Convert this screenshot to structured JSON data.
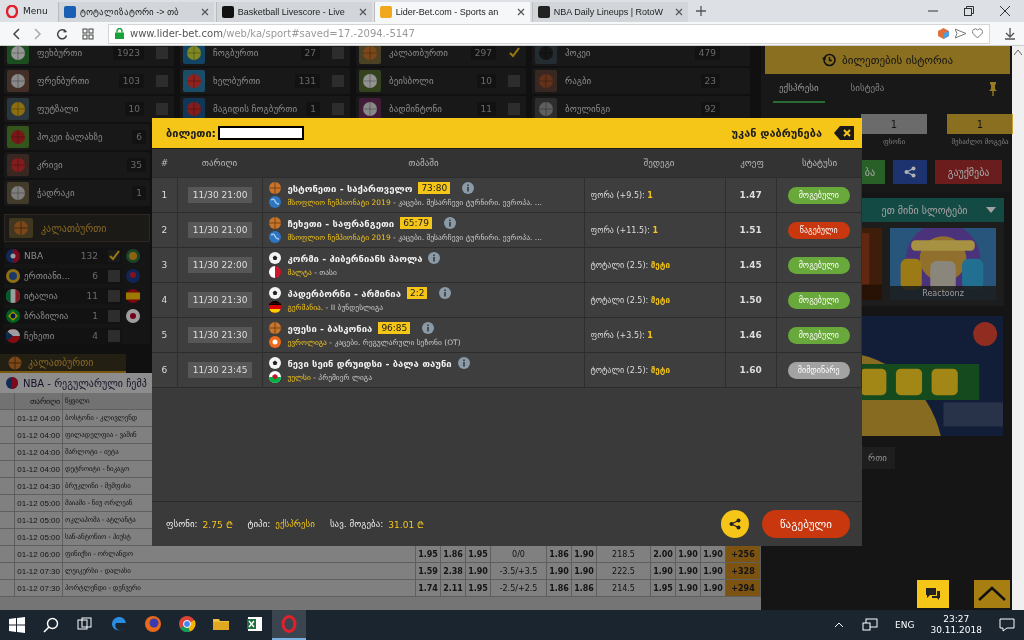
{
  "browser": {
    "menu": "Menu",
    "tabs": [
      {
        "label": "ტოტალიზატორი -> თბ",
        "selected": false
      },
      {
        "label": "Basketball Livescore - Live",
        "selected": false
      },
      {
        "label": "Lider-Bet.com - Sports an",
        "selected": true
      },
      {
        "label": "NBA Daily Lineups | RotoW",
        "selected": false
      }
    ],
    "url_host": "www.lider-bet.com",
    "url_path": "/web/ka/sport#saved=17.-2094.-5147"
  },
  "sports": [
    [
      {
        "name": "ფეხბურთი",
        "count": "1923",
        "checked": false,
        "kind": "football"
      },
      {
        "name": "ფრენბურთი",
        "count": "103",
        "checked": false,
        "kind": "volleyball"
      },
      {
        "name": "ფუტზალი",
        "count": "10",
        "checked": false,
        "kind": "futsal"
      },
      {
        "name": "ჰოკეი ბალახზე",
        "count": "6",
        "kind": "fieldhockey"
      },
      {
        "name": "კრივი",
        "count": "35",
        "kind": "boxing"
      },
      {
        "name": "ჭადრაკი",
        "count": "1",
        "kind": "chess"
      }
    ],
    [
      {
        "name": "ჩოგბურთი",
        "count": "27",
        "checked": false,
        "kind": "tennis"
      },
      {
        "name": "ხელბურთი",
        "count": "131",
        "checked": false,
        "kind": "handball"
      },
      {
        "name": "მაგიდის ჩოგბურთი",
        "count": "1",
        "checked": false,
        "kind": "tabletennis"
      }
    ],
    [
      {
        "name": "კალათბურთი",
        "count": "297",
        "checked": true,
        "kind": "basketball"
      },
      {
        "name": "ბეისბოლი",
        "count": "10",
        "checked": false,
        "kind": "baseball"
      },
      {
        "name": "ბადმინტონი",
        "count": "11",
        "checked": false,
        "kind": "badminton"
      }
    ],
    [
      {
        "name": "ჰოკეი",
        "count": "479",
        "kind": "icehockey"
      },
      {
        "name": "რაგბი",
        "count": "23",
        "kind": "rugby"
      },
      {
        "name": "ბოულინგი",
        "count": "92",
        "kind": "other"
      }
    ]
  ],
  "basketball_panel": {
    "title": "კალათბურთი",
    "leagues": [
      {
        "name": "NBA",
        "count": "132",
        "checked": true,
        "kind": "nba"
      },
      {
        "name": "ერთიანი...",
        "count": "6",
        "checked": false,
        "kind": "intl"
      },
      {
        "name": "იტალია",
        "count": "11",
        "checked": false,
        "kind": "italy"
      },
      {
        "name": "ბრაზილია",
        "count": "1",
        "checked": false,
        "kind": "brazil"
      },
      {
        "name": "ჩეხეთი",
        "count": "4",
        "checked": false,
        "kind": "czech"
      }
    ],
    "partial_flags": [
      {
        "kind": "ball"
      },
      {
        "kind": "team"
      },
      {
        "kind": "spain"
      },
      {
        "kind": "japan"
      }
    ]
  },
  "schedule": {
    "tab": "კალათბურთი",
    "title": "NBA - რეგულარული ჩემპ",
    "columns": [
      "თარიღი",
      "წყვილი"
    ],
    "rows": [
      {
        "date": "01-12 04:00",
        "pair": "ბოსტონი - კლივლენდ"
      },
      {
        "date": "01-12 04:00",
        "pair": "ფილადელფია - ვაშინ"
      },
      {
        "date": "01-12 04:00",
        "pair": "შარლოტი - იუტა"
      },
      {
        "date": "01-12 04:00",
        "pair": "დეტროიტი - ჩიკაგო"
      },
      {
        "date": "01-12 04:30",
        "pair": "ბრუკლინი - მემფისი"
      },
      {
        "date": "01-12 05:00",
        "pair": "მაიამი - ნიუ ორლეან"
      },
      {
        "date": "01-12 05:00",
        "pair": "ოკლაჰომა - ატლანტა"
      },
      {
        "date": "01-12 05:00",
        "pair": "სან-ანტონიო - ჰიუსტ"
      },
      {
        "date": "01-12 06:00",
        "pair": "ფინიქსი - ორლანდო",
        "odds": [
          "1.95",
          "1.86",
          "1.95",
          "0/0",
          "1.86",
          "1.90",
          "218.5",
          "2.00",
          "1.90",
          "1.90"
        ],
        "more": "+256"
      },
      {
        "date": "01-12 07:30",
        "pair": "ლეიკერსი - დალასი",
        "odds": [
          "1.59",
          "2.38",
          "1.90",
          "-3.5/+3.5",
          "1.90",
          "1.90",
          "222.5",
          "1.90",
          "1.90",
          "1.90"
        ],
        "more": "+328"
      },
      {
        "date": "01-12 07:30",
        "pair": "პორტლენდი - დენვერი",
        "odds": [
          "1.74",
          "2.11",
          "1.95",
          "-2.5/+2.5",
          "1.86",
          "1.86",
          "214.5",
          "1.95",
          "1.90",
          "1.90"
        ],
        "more": "+294"
      }
    ]
  },
  "betslip": {
    "history_button": "ბილეთების ისტორია",
    "tabs": [
      {
        "label": "ექსპრესი",
        "selected": true
      },
      {
        "label": "სისტემა",
        "selected": false
      }
    ],
    "fields": [
      {
        "value": "1",
        "label": "ფსონი",
        "kind": "stake"
      },
      {
        "value": "1",
        "label": "შესაძლო მოგება",
        "kind": "win"
      }
    ],
    "place_button": "ბა",
    "cancel_button": "გაუქმება",
    "slots_title": "ეთ მინი სლოტები",
    "slot_caption": "Reactoonz",
    "more_button": "რთი"
  },
  "modal": {
    "ticket_label": "ბილეთი:",
    "back": "უკან დაბრუნება",
    "columns": [
      "#",
      "თარიღი",
      "თამაში",
      "შედეგი",
      "კოეფ",
      "სტატუსი"
    ],
    "rows": [
      {
        "num": "1",
        "date": "11/30 21:00",
        "kind": "basketball",
        "teams": "ესტონეთი - საქართველო",
        "score": "73:80",
        "flag": {
          "kind": "world"
        },
        "league": "მსოფლიო ჩემპიონატი 2019",
        "league_rest": " - კაცები. შესარჩევი ტურნირი. ევროპა. ...",
        "bet": "ფორა (+9.5): ",
        "pick": "1",
        "odds": "1.47",
        "status": {
          "label": "მოგებული",
          "kind": "won"
        }
      },
      {
        "num": "2",
        "date": "11/30 21:00",
        "kind": "basketball",
        "teams": "ჩეხეთი - საფრანგეთი",
        "score": "65:79",
        "flag": {
          "kind": "world"
        },
        "league": "მსოფლიო ჩემპიონატი 2019",
        "league_rest": " - კაცები. შესარჩევი ტურნირი. ევროპა. ...",
        "bet": "ფორა (+11.5): ",
        "pick": "1",
        "odds": "1.51",
        "status": {
          "label": "წაგებული",
          "kind": "lost"
        }
      },
      {
        "num": "3",
        "date": "11/30 22:00",
        "kind": "football",
        "teams": "კორმი - ჰიბერნიანს პაოლა",
        "flag": {
          "kind": "malta"
        },
        "league": "მალტა",
        "league_rest": " - თასი",
        "bet": "ტოტალი (2.5): ",
        "pick": "მეტი",
        "odds": "1.45",
        "status": {
          "label": "მოგებული",
          "kind": "won"
        }
      },
      {
        "num": "4",
        "date": "11/30 21:30",
        "kind": "football",
        "teams": "პადერბორნი - არმინია",
        "score": "2:2",
        "flag": {
          "kind": "germany"
        },
        "league": "გერმანია.",
        "league_rest": " - II ბუნდესლიგა",
        "bet": "ტოტალი (2.5): ",
        "pick": "მეტი",
        "odds": "1.50",
        "status": {
          "label": "მოგებული",
          "kind": "won"
        }
      },
      {
        "num": "5",
        "date": "11/30 21:30",
        "kind": "basketball",
        "teams": "ეფესი - ბასკონია",
        "score": "96:85",
        "flag": {
          "kind": "euroleague"
        },
        "league": "ევროლიგა",
        "league_rest": " - კაცები. რეგულარული სეზონი (OT)",
        "bet": "ფორა (+3.5): ",
        "pick": "1",
        "odds": "1.46",
        "status": {
          "label": "მოგებული",
          "kind": "won"
        }
      },
      {
        "num": "6",
        "date": "11/30 23:45",
        "kind": "football",
        "teams": "ნევი სეინ დრუიდსი - ბალა თაუნი",
        "flag": {
          "kind": "wales"
        },
        "league": "უელსი",
        "league_rest": " - პრემიერ ლიგა",
        "bet": "ტოტალი (2.5): ",
        "pick": "მეტი",
        "odds": "1.60",
        "status": {
          "label": "მიმდინარე",
          "kind": "pending"
        }
      }
    ],
    "footer": {
      "stake_label": "ფსონი:",
      "stake": "2.75 ₾",
      "type_label": "ტიპი:",
      "type": "ექსპრესი",
      "win_label": "სავ. მოგება:",
      "win": "31.01 ₾",
      "result_button": "წაგებული"
    }
  },
  "taskbar": {
    "apps": [
      {
        "kind": "edge",
        "selected": false
      },
      {
        "kind": "firefox",
        "selected": false
      },
      {
        "kind": "chrome",
        "selected": false
      },
      {
        "kind": "folder",
        "selected": false
      },
      {
        "kind": "excel",
        "selected": false
      },
      {
        "kind": "opera",
        "selected": true
      }
    ],
    "lang": "ENG",
    "time": "23:27",
    "date": "30.11.2018"
  }
}
